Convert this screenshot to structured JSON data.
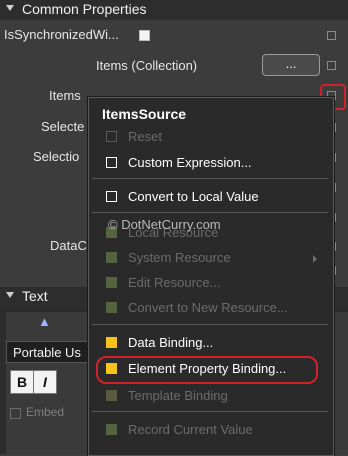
{
  "common_properties": {
    "header": "Common Properties",
    "is_synchronized_label": "IsSynchronizedWi...",
    "items_label": "Items (Collection)",
    "items_button": "...",
    "items_source_label": "Items",
    "selected_label": "Selecte",
    "selection_label": "Selectio",
    "data_label": "DataC"
  },
  "text_section": {
    "header": "Text",
    "font_value": "Portable Us",
    "bold_label": "B",
    "italic_label": "I",
    "embed_label": "Embed"
  },
  "menu": {
    "title": "ItemsSource",
    "items": [
      {
        "label": "Reset",
        "enabled": false
      },
      {
        "label": "Custom Expression...",
        "enabled": true
      },
      {
        "label": "Convert to Local Value",
        "enabled": true
      },
      {
        "label": "Local Resource",
        "enabled": false
      },
      {
        "label": "System Resource",
        "enabled": false
      },
      {
        "label": "Edit Resource...",
        "enabled": false
      },
      {
        "label": "Convert to New Resource...",
        "enabled": false
      },
      {
        "label": "Data Binding...",
        "enabled": true
      },
      {
        "label": "Element Property Binding...",
        "enabled": true
      },
      {
        "label": "Template Binding",
        "enabled": false
      },
      {
        "label": "Record Current Value",
        "enabled": false
      }
    ]
  },
  "watermark": "© DotNetCurry.com",
  "colors": {
    "highlight_red": "#d3212c",
    "binding_yellow": "#f6c21b",
    "menu_bg": "#2a2a2a",
    "panel_bg": "#3c3c3c"
  }
}
